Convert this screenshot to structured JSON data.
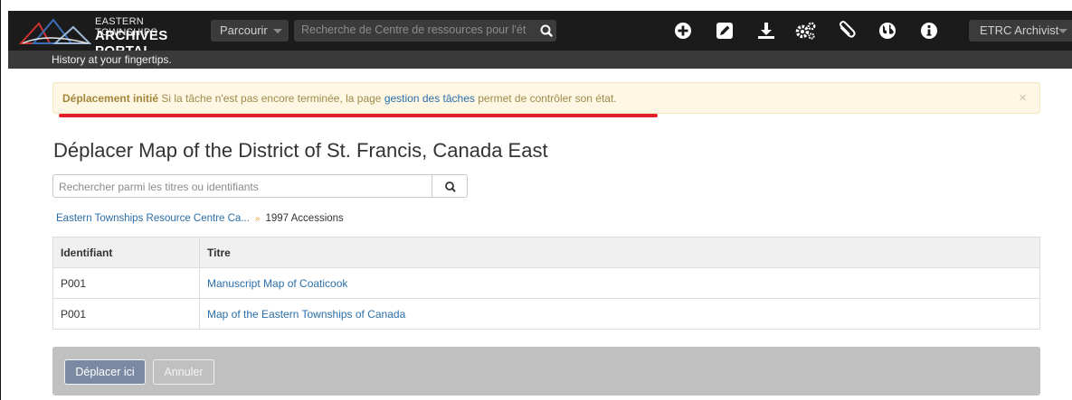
{
  "header": {
    "logo_top": "EASTERN TOWNSHIPS",
    "logo_bottom": "ARCHIVES PORTAL",
    "browse_label": "Parcourir",
    "search_placeholder": "Recherche de Centre de ressources pour l'ét",
    "user_label": "ETRC Archivist",
    "icons": [
      "plus-circle-icon",
      "edit-icon",
      "download-icon",
      "cogs-icon",
      "paperclip-icon",
      "globe-icon",
      "info-icon"
    ],
    "tagline": "History at your fingertips."
  },
  "alert": {
    "strong": "Déplacement initié",
    "text_before": " Si la tâche n'est pas encore terminée, la page ",
    "link": "gestion des tâches",
    "text_after": " permet de contrôler son état.",
    "close": "×"
  },
  "page": {
    "title": "Déplacer Map of the District of St. Francis, Canada East",
    "search_placeholder": "Rechercher parmi les titres ou identifiants"
  },
  "breadcrumb": {
    "link": "Eastern Townships Resource Centre Ca...",
    "separator": "»",
    "current": "1997 Accessions"
  },
  "table": {
    "headers": [
      "Identifiant",
      "Titre"
    ],
    "rows": [
      {
        "id": "P001",
        "title": "Manuscript Map of Coaticook"
      },
      {
        "id": "P001",
        "title": "Map of the Eastern Townships of Canada"
      }
    ]
  },
  "actions": {
    "move_label": "Déplacer ici",
    "cancel_label": "Annuler"
  },
  "colors": {
    "navbar": "#1b1b1b",
    "link": "#2b6ea8",
    "alert_bg": "#fdf7e3",
    "underline": "#e0212a"
  }
}
